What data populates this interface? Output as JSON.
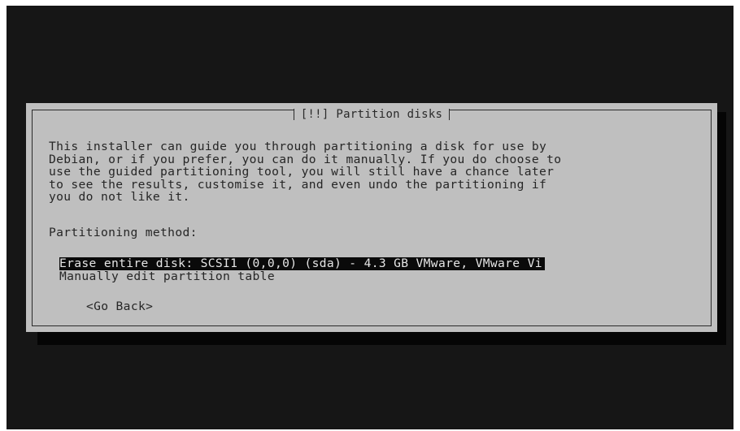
{
  "dialog": {
    "title": "[!!] Partition disks",
    "description_lines": [
      "This installer can guide you through partitioning a disk for use by",
      "Debian, or if you prefer, you can do it manually. If you do choose to",
      "use the guided partitioning tool, you will still have a chance later",
      "to see the results, customise it, and even undo the partitioning if",
      "you do not like it."
    ],
    "method_label": "Partitioning method:",
    "options": [
      {
        "label": "Erase entire disk: SCSI1 (0,0,0) (sda) - 4.3 GB VMware, VMware Vi",
        "selected": true
      },
      {
        "label": "Manually edit partition table",
        "selected": false
      }
    ],
    "go_back_label": "<Go Back>"
  }
}
